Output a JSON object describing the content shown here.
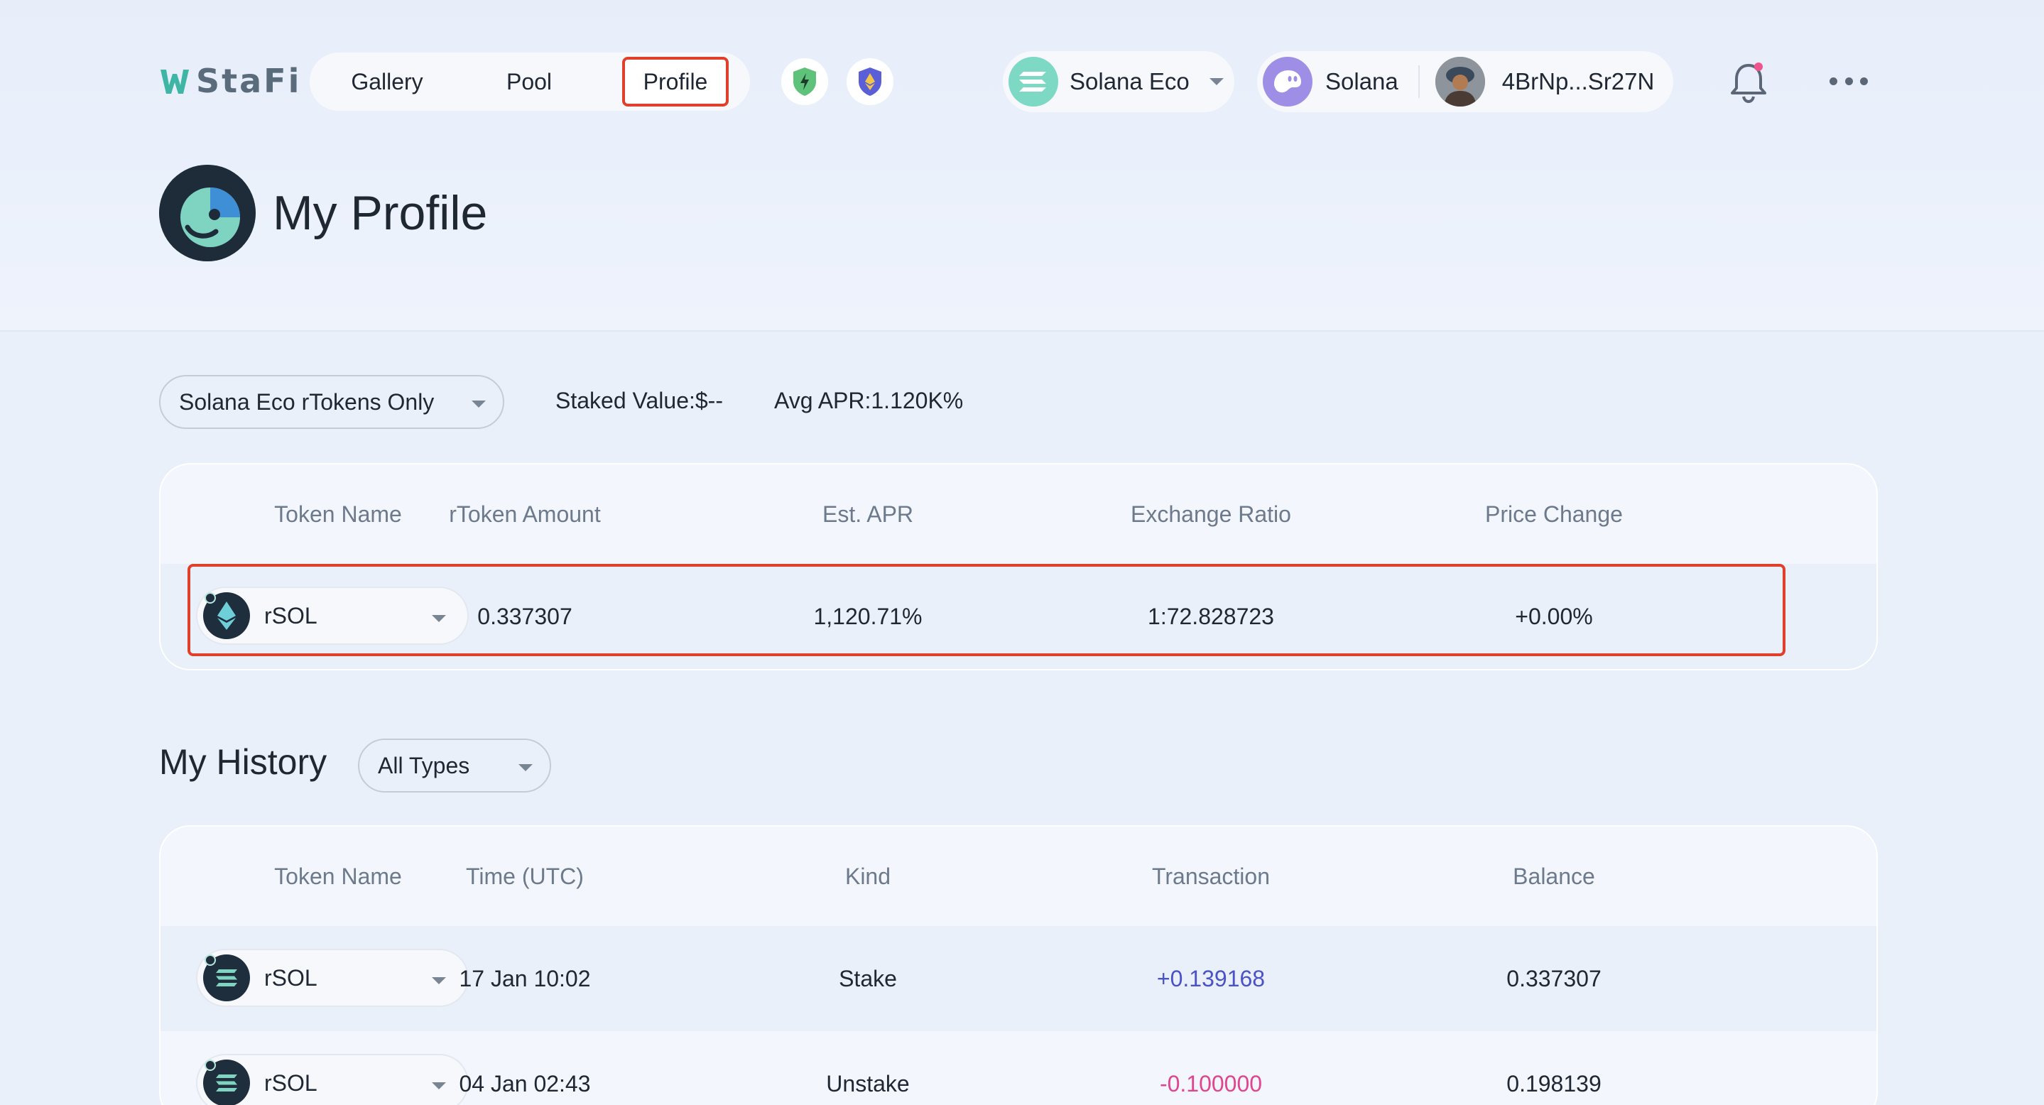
{
  "header": {
    "logo_text": "StaFi",
    "nav": {
      "gallery": "Gallery",
      "pool": "Pool",
      "profile": "Profile"
    },
    "ecosystem": "Solana Eco",
    "network": "Solana",
    "wallet_address": "4BrNp...Sr27N"
  },
  "page": {
    "title": "My Profile"
  },
  "filters": {
    "ecosystem_select": "Solana Eco rTokens Only",
    "staked_value": "Staked Value:$--",
    "avg_apr": "Avg APR:1.120K%"
  },
  "rtoken_table": {
    "headers": [
      "Token Name",
      "rToken Amount",
      "Est. APR",
      "Exchange Ratio",
      "Price Change"
    ],
    "rows": [
      {
        "token": "rSOL",
        "amount": "0.337307",
        "apr": "1,120.71%",
        "ratio": "1:72.828723",
        "change": "+0.00%"
      }
    ]
  },
  "history": {
    "title": "My History",
    "type_select": "All Types",
    "headers": [
      "Token Name",
      "Time (UTC)",
      "Kind",
      "Transaction",
      "Balance"
    ],
    "rows": [
      {
        "token": "rSOL",
        "time": "17 Jan 10:02",
        "kind": "Stake",
        "transaction": "+0.139168",
        "balance": "0.337307"
      },
      {
        "token": "rSOL",
        "time": "04 Jan 02:43",
        "kind": "Unstake",
        "transaction": "-0.100000",
        "balance": "0.198139"
      }
    ]
  },
  "colors": {
    "highlight": "#e0402b",
    "positive": "#4a52c8",
    "negative": "#e0458f",
    "background": "#eaf0fa"
  }
}
